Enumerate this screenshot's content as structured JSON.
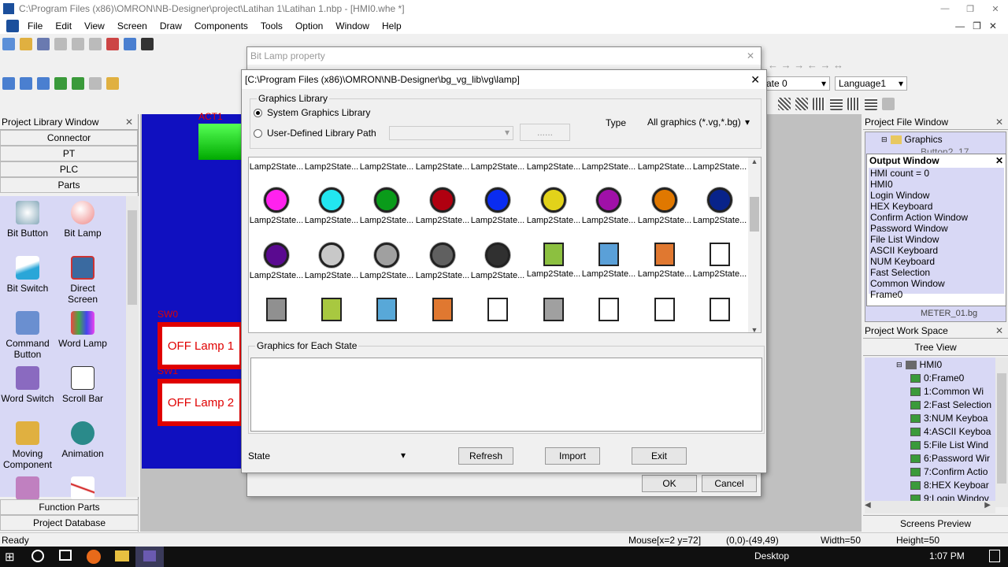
{
  "window": {
    "title": "C:\\Program Files (x86)\\OMRON\\NB-Designer\\project\\Latihan 1\\Latihan 1.nbp - [HMI0.whe *]"
  },
  "menu": [
    "File",
    "Edit",
    "View",
    "Screen",
    "Draw",
    "Components",
    "Tools",
    "Option",
    "Window",
    "Help"
  ],
  "toolbar": {
    "state_select": "ate 0",
    "language_select": "Language1"
  },
  "library": {
    "title": "Project Library Window",
    "connector": "Connector",
    "pt": "PT",
    "plc": "PLC",
    "parts": "Parts",
    "function_parts": "Function Parts",
    "project_database": "Project Database",
    "items": [
      "Bit Button",
      "Bit Lamp",
      "Bit Switch",
      "Direct Screen",
      "Command Button",
      "Word Lamp",
      "Word Switch",
      "Scroll Bar",
      "Moving Component",
      "Animation"
    ]
  },
  "canvas": {
    "act_label": "ACT1",
    "sw0": "SW0",
    "sw1": "SW1",
    "lamp1": "OFF Lamp 1",
    "lamp2": "OFF Lamp 2"
  },
  "bitlamp_dialog": {
    "title": "Bit Lamp property",
    "ok": "OK",
    "cancel": "Cancel"
  },
  "gfx_dialog": {
    "path": "[C:\\Program Files (x86)\\OMRON\\NB-Designer\\bg_vg_lib\\vg\\lamp]",
    "graphics_library": "Graphics Library",
    "system_lib": "System Graphics Library",
    "user_lib": "User-Defined Library Path",
    "browse": "......",
    "type_label": "Type",
    "type_value": "All graphics (*.vg,*.bg)",
    "cell_label": "Lamp2State...",
    "each_state": "Graphics for Each State",
    "state_label": "State",
    "refresh": "Refresh",
    "import": "Import",
    "exit": "Exit"
  },
  "colors": {
    "row1": [
      "#ff22ee",
      "#22e6f0",
      "#0a9b1a",
      "#b00010",
      "#0a2cf0",
      "#e2d21a",
      "#a010a8",
      "#e07800",
      "#08238a"
    ],
    "row2": [
      "#5a0a90",
      "#c8c8c8",
      "#a0a0a0",
      "#606060",
      "#303030",
      "#8cc040",
      "#5aa0d8",
      "#e07830",
      "#ffffff"
    ],
    "row3": [
      "#909090",
      "#a8c840",
      "#58a8d8",
      "#e07830",
      "#ffffff",
      "#a0a0a0",
      "#ffffff",
      "#ffffff",
      "#ffffff"
    ]
  },
  "project_file": {
    "title": "Project File Window",
    "graphics": "Graphics",
    "partial": "Button2_17"
  },
  "output": {
    "title": "Output Window",
    "lines": [
      "HMI count = 0",
      "HMI0",
      "Login Window",
      "HEX Keyboard",
      "Confirm Action Window",
      "Password Window",
      "File List Window",
      "ASCII Keyboard",
      "NUM Keyboard",
      "Fast Selection",
      "Common Window",
      "Frame0"
    ],
    "partial": "METER_01.bg"
  },
  "workspace": {
    "title": "Project Work Space",
    "tree_view": "Tree View",
    "root": "HMI0",
    "items": [
      "0:Frame0",
      "1:Common Wi",
      "2:Fast Selection",
      "3:NUM Keyboa",
      "4:ASCII Keyboa",
      "5:File List Wind",
      "6:Password Wir",
      "7:Confirm Actio",
      "8:HEX Keyboar",
      "9:Login Windov"
    ],
    "screens_preview": "Screens Preview"
  },
  "status": {
    "ready": "Ready",
    "mouse": "Mouse[x=2  y=72]",
    "coords": "(0,0)-(49,49)",
    "width": "Width=50",
    "height": "Height=50"
  },
  "taskbar": {
    "desktop": "Desktop",
    "time": "1:07 PM"
  }
}
